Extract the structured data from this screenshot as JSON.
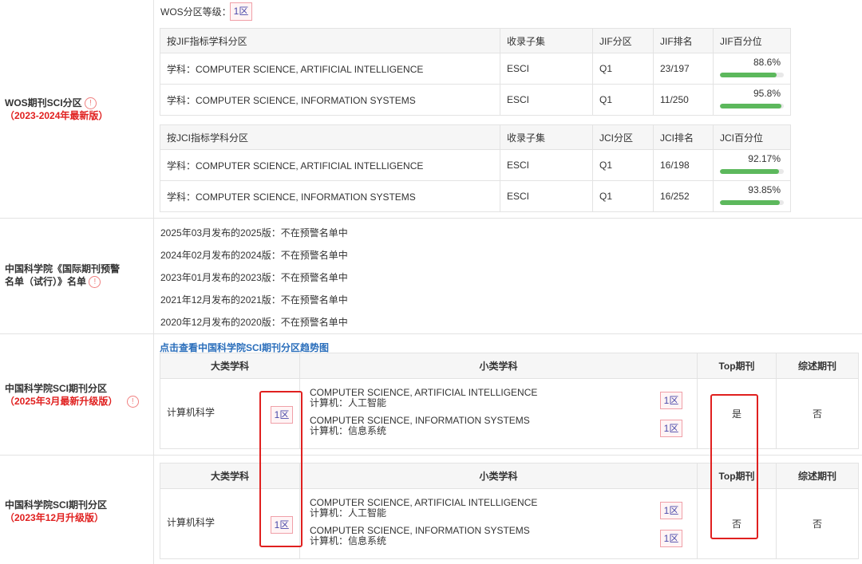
{
  "wos": {
    "label": "WOS期刊SCI分区",
    "sublabel": "（2023-2024年最新版）",
    "grade_label": "WOS分区等级：",
    "grade_value": "1区",
    "jif_headers": [
      "按JIF指标学科分区",
      "收录子集",
      "JIF分区",
      "JIF排名",
      "JIF百分位"
    ],
    "jif_rows": [
      {
        "subject": "学科：COMPUTER SCIENCE, ARTIFICIAL INTELLIGENCE",
        "set": "ESCI",
        "zone": "Q1",
        "rank": "23/197",
        "pct_text": "88.6%",
        "pct": 88.6
      },
      {
        "subject": "学科：COMPUTER SCIENCE, INFORMATION SYSTEMS",
        "set": "ESCI",
        "zone": "Q1",
        "rank": "11/250",
        "pct_text": "95.8%",
        "pct": 95.8
      }
    ],
    "jci_headers": [
      "按JCI指标学科分区",
      "收录子集",
      "JCI分区",
      "JCI排名",
      "JCI百分位"
    ],
    "jci_rows": [
      {
        "subject": "学科：COMPUTER SCIENCE, ARTIFICIAL INTELLIGENCE",
        "set": "ESCI",
        "zone": "Q1",
        "rank": "16/198",
        "pct_text": "92.17%",
        "pct": 92.17
      },
      {
        "subject": "学科：COMPUTER SCIENCE, INFORMATION SYSTEMS",
        "set": "ESCI",
        "zone": "Q1",
        "rank": "16/252",
        "pct_text": "93.85%",
        "pct": 93.85
      }
    ]
  },
  "warning": {
    "label_line1": "中国科学院《国际期刊预警",
    "label_line2": "名单（试行）》名单",
    "items": [
      "2025年03月发布的2025版：不在预警名单中",
      "2024年02月发布的2024版：不在预警名单中",
      "2023年01月发布的2023版：不在预警名单中",
      "2021年12月发布的2021版：不在预警名单中",
      "2020年12月发布的2020版：不在预警名单中"
    ]
  },
  "cas2025": {
    "label": "中国科学院SCI期刊分区",
    "sublabel": "（2025年3月最新升级版）",
    "trend_link": "点击查看中国科学院SCI期刊分区趋势图",
    "headers": [
      "大类学科",
      "小类学科",
      "Top期刊",
      "综述期刊"
    ],
    "major": "计算机科学",
    "major_zone": "1区",
    "minors": [
      {
        "en": "COMPUTER SCIENCE, ARTIFICIAL INTELLIGENCE",
        "cn": "计算机：人工智能",
        "zone": "1区"
      },
      {
        "en": "COMPUTER SCIENCE, INFORMATION SYSTEMS",
        "cn": "计算机：信息系统",
        "zone": "1区"
      }
    ],
    "top": "是",
    "review": "否"
  },
  "cas2023": {
    "label": "中国科学院SCI期刊分区",
    "sublabel": "（2023年12月升级版）",
    "headers": [
      "大类学科",
      "小类学科",
      "Top期刊",
      "综述期刊"
    ],
    "major": "计算机科学",
    "major_zone": "1区",
    "minors": [
      {
        "en": "COMPUTER SCIENCE, ARTIFICIAL INTELLIGENCE",
        "cn": "计算机：人工智能",
        "zone": "1区"
      },
      {
        "en": "COMPUTER SCIENCE, INFORMATION SYSTEMS",
        "cn": "计算机：信息系统",
        "zone": "1区"
      }
    ],
    "top": "否",
    "review": "否"
  },
  "icons": {
    "info": "info-circle-icon"
  },
  "colors": {
    "accent_red": "#e0201f",
    "progress_green": "#5cb85c",
    "link_blue": "#2a6ebb"
  }
}
